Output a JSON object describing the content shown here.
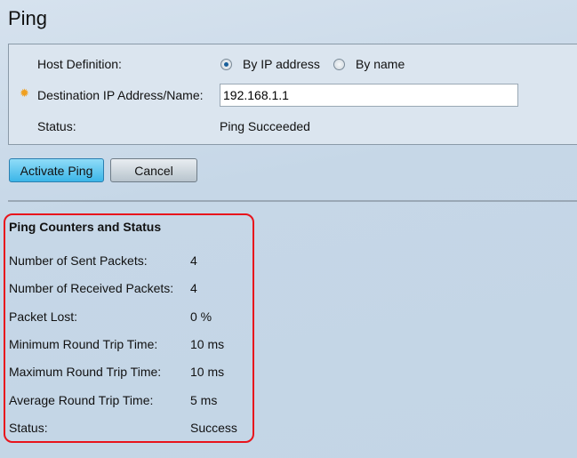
{
  "page_title": "Ping",
  "form": {
    "host_definition_label": "Host Definition:",
    "option_ip": "By IP address",
    "option_name": "By name",
    "destination_label": "Destination IP Address/Name:",
    "destination_value": "192.168.1.1",
    "status_label": "Status:",
    "status_value": "Ping Succeeded"
  },
  "buttons": {
    "activate": "Activate Ping",
    "cancel": "Cancel"
  },
  "counters": {
    "title": "Ping Counters and Status",
    "rows": [
      {
        "label": "Number of Sent Packets:",
        "value": "4"
      },
      {
        "label": "Number of Received Packets:",
        "value": "4"
      },
      {
        "label": "Packet Lost:",
        "value": "0 %"
      },
      {
        "label": "Minimum Round Trip Time:",
        "value": "10 ms"
      },
      {
        "label": "Maximum Round Trip Time:",
        "value": "10 ms"
      },
      {
        "label": "Average Round Trip Time:",
        "value": "5 ms"
      },
      {
        "label": "Status:",
        "value": "Success"
      }
    ]
  },
  "colors": {
    "highlight": "#e8141c",
    "required": "#f0a020"
  }
}
